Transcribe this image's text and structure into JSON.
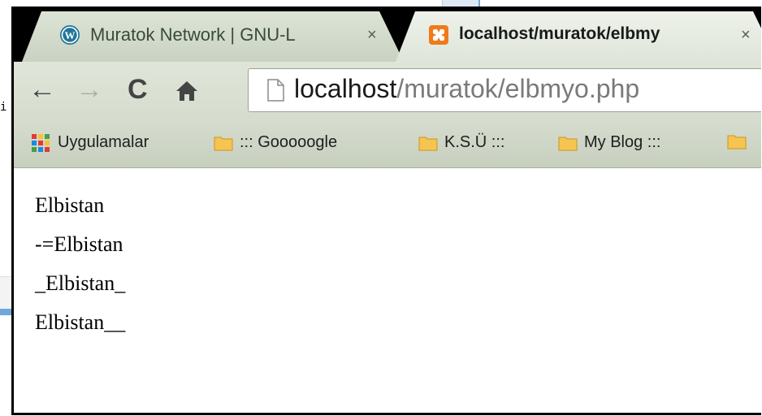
{
  "background": {
    "fragment_text": "i"
  },
  "tabs": [
    {
      "title": "Muratok Network | GNU-L",
      "close": "×",
      "icon": "wordpress-icon",
      "active": false
    },
    {
      "title": "localhost/muratok/elbmy",
      "close": "×",
      "icon": "xampp-icon",
      "active": true
    }
  ],
  "toolbar": {
    "back": "←",
    "forward": "→",
    "reload": "C",
    "home": "⌂",
    "url_host": "localhost",
    "url_path": "/muratok/elbmyo.php"
  },
  "bookmarks": {
    "apps_label": "Uygulamalar",
    "items": [
      {
        "label": "::: Gooooogle",
        "icon": "folder-icon"
      },
      {
        "label": "K.S.Ü :::",
        "icon": "folder-icon"
      },
      {
        "label": "My Blog :::",
        "icon": "folder-icon"
      },
      {
        "label": "",
        "icon": "folder-icon"
      }
    ]
  },
  "content": {
    "lines": [
      "Elbistan",
      "-=Elbistan",
      "_Elbistan_",
      "Elbistan__"
    ]
  },
  "colors": {
    "tab_icon_xampp": "#f07a1a",
    "tab_icon_wordpress": "#21759b",
    "folder": "#f5c451"
  }
}
